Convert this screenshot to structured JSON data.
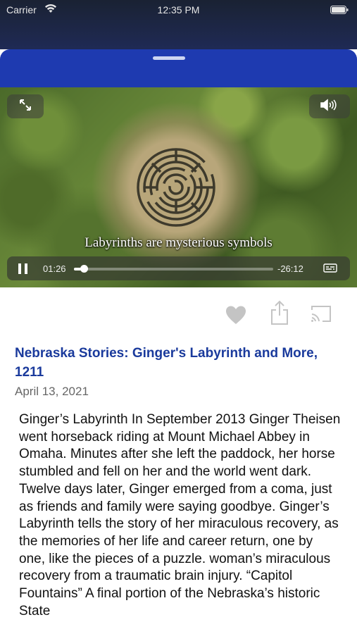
{
  "status_bar": {
    "carrier": "Carrier",
    "time": "12:35 PM"
  },
  "player": {
    "subtitle": "Labyrinths are mysterious symbols",
    "elapsed": "01:26",
    "remaining": "-26:12",
    "progress_fraction": 0.05
  },
  "icons": {
    "expand": "expand-arrows-icon",
    "volume": "speaker-volume-icon",
    "pause": "pause-icon",
    "captions": "captions-icon",
    "favorite": "heart-icon",
    "share": "share-icon",
    "cast": "cast-icon"
  },
  "episode": {
    "title": "Nebraska Stories: Ginger's Labyrinth and More, 1211",
    "date": "April 13, 2021",
    "description": "Ginger’s Labyrinth In September 2013 Ginger Theisen went horseback riding at Mount Michael Abbey in Omaha.  Minutes after she left the paddock, her horse stumbled and fell on her and the world went dark. Twelve days later, Ginger emerged from a coma, just as friends and family were saying goodbye. Ginger’s Labyrinth tells the story of her miraculous recovery, as the memories of her life and career return, one by one, like the pieces of a puzzle. woman’s miraculous recovery from a traumatic brain injury. “Capitol Fountains”  A final portion of the Nebraska’s historic State"
  },
  "colors": {
    "accent": "#1a3a9c",
    "sheet": "#1e3ab0",
    "icon_gray": "#c4c4c4"
  }
}
